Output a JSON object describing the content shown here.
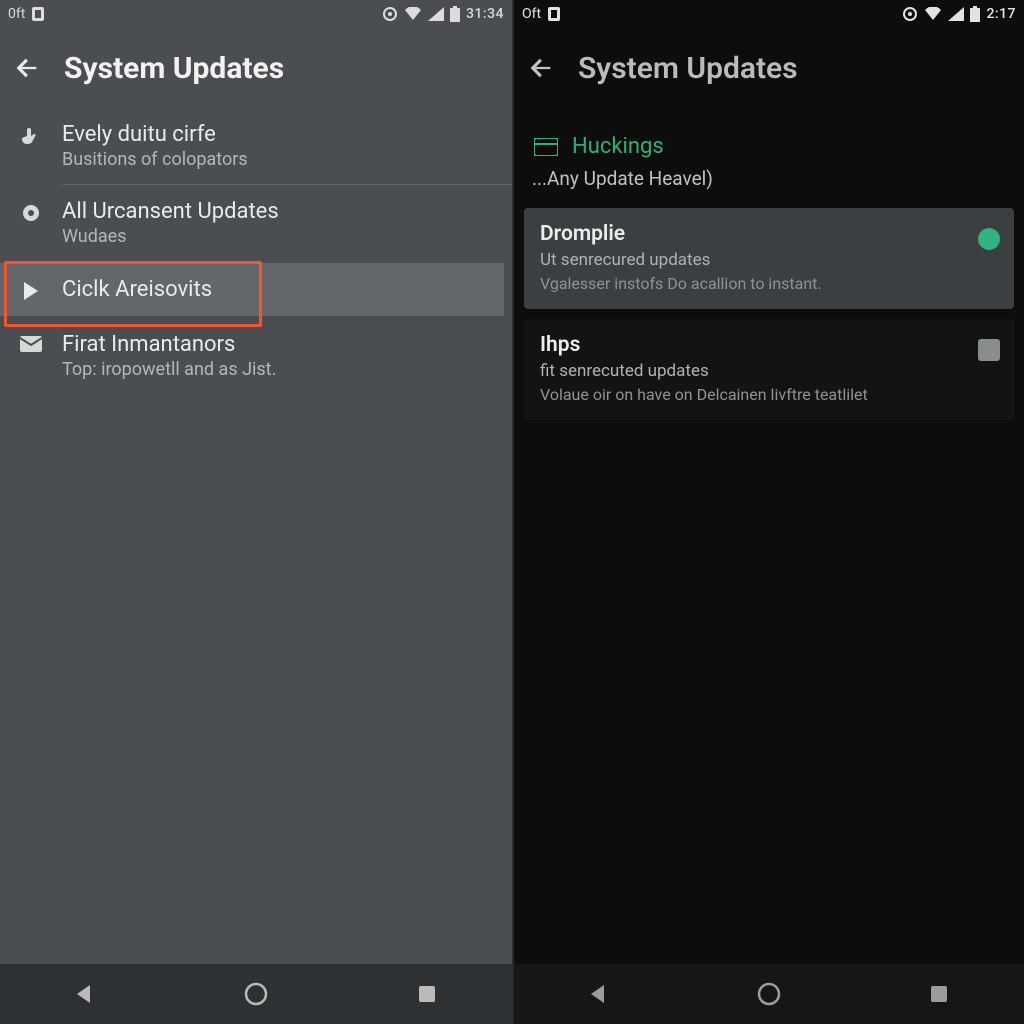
{
  "left": {
    "status": {
      "leftText": "0ft",
      "time": "31:34"
    },
    "title": "System Updates",
    "items": [
      {
        "icon": "hand-icon",
        "title": "Evely duitu cirfe",
        "subtitle": "Busitions of colopators"
      },
      {
        "icon": "disc-icon",
        "title": "All Urcansent Updates",
        "subtitle": "Wudaes"
      },
      {
        "icon": "play-icon",
        "title": "Ciclk Areisovits",
        "subtitle": ""
      },
      {
        "icon": "mail-icon",
        "title": "Firat Inmantanors",
        "subtitle": "Top: iropowetll and as Jist."
      }
    ]
  },
  "right": {
    "status": {
      "leftText": "Oft",
      "time": "2:17"
    },
    "title": "System Updates",
    "sectionLabel": "Huckings",
    "subheading": "...Any Update Heavel)",
    "cards": [
      {
        "title": "Dromplie",
        "line1": "Ut senrecured updates",
        "line2": "Vgalesser instofs Do acallion to instant.",
        "control": "radio-on"
      },
      {
        "title": "Ihps",
        "line1": "fit senrecuted updates",
        "line2": "Volaue oir on have on Delcainen livftre teatlilet",
        "control": "checkbox"
      }
    ]
  }
}
